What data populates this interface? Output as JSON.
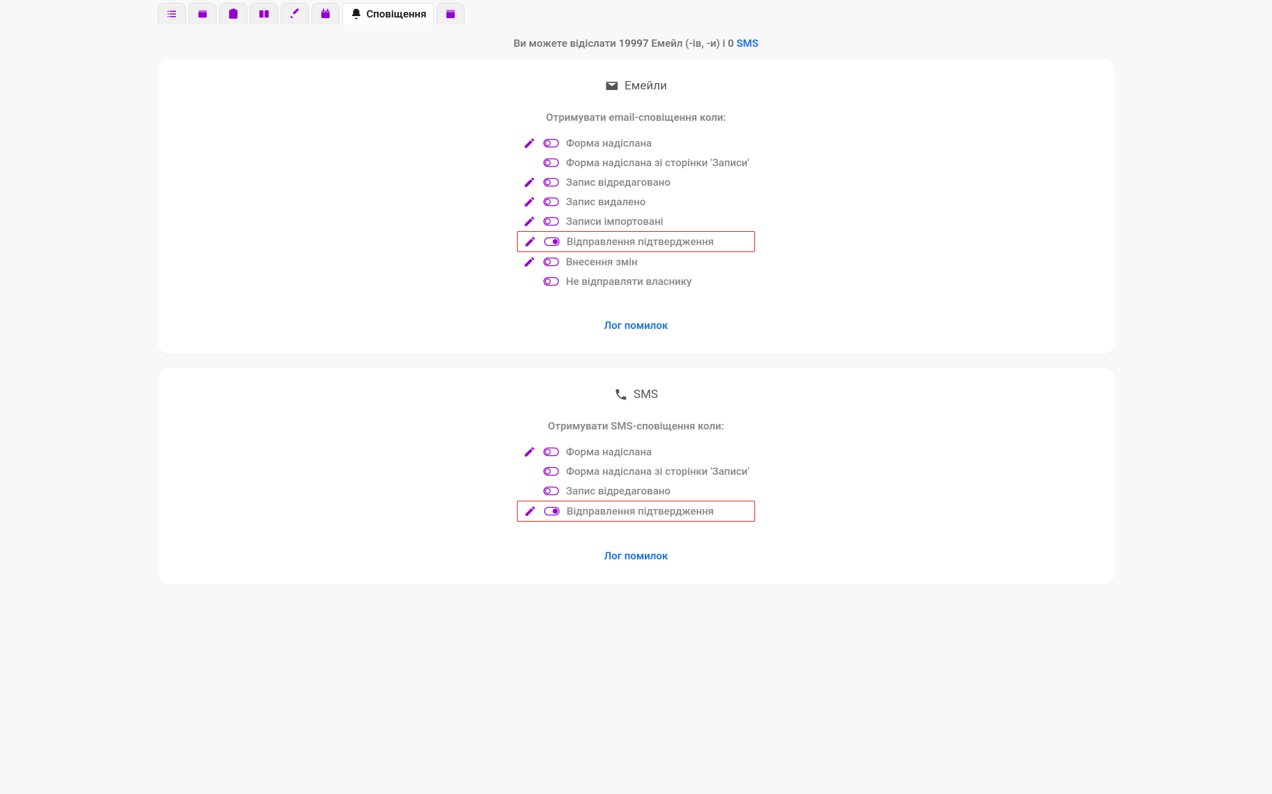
{
  "tabs": {
    "active_label": "Сповіщення"
  },
  "info": {
    "prefix": "Ви можете відіслати",
    "email_count": "19997",
    "email_unit": "Емейл (-ів, -и)",
    "and": "і",
    "sms_count": "0",
    "sms_link": "SMS"
  },
  "emails": {
    "title": "Емейли",
    "subtitle": "Отримувати email-сповіщення коли:",
    "items": [
      {
        "label": "Форма надіслана",
        "edit": true,
        "on": false
      },
      {
        "label": "Форма надіслана зі сторінки 'Записи'",
        "edit": false,
        "on": false
      },
      {
        "label": "Запис відредаговано",
        "edit": true,
        "on": false
      },
      {
        "label": "Запис видалено",
        "edit": true,
        "on": false
      },
      {
        "label": "Записи імпортовані",
        "edit": true,
        "on": false
      },
      {
        "label": "Відправлення підтвердження",
        "edit": true,
        "on": true,
        "hl": true
      },
      {
        "label": "Внесення змін",
        "edit": true,
        "on": false
      },
      {
        "label": "Не відправляти власнику",
        "edit": false,
        "on": false
      }
    ],
    "log_link": "Лог помилок"
  },
  "sms": {
    "title": "SMS",
    "subtitle": "Отримувати SMS-сповіщення коли:",
    "items": [
      {
        "label": "Форма надіслана",
        "edit": true,
        "on": false
      },
      {
        "label": "Форма надіслана зі сторінки 'Записи'",
        "edit": false,
        "on": false
      },
      {
        "label": "Запис відредаговано",
        "edit": false,
        "on": false
      },
      {
        "label": "Відправлення підтвердження",
        "edit": true,
        "on": true,
        "hl": true
      }
    ],
    "log_link": "Лог помилок"
  }
}
